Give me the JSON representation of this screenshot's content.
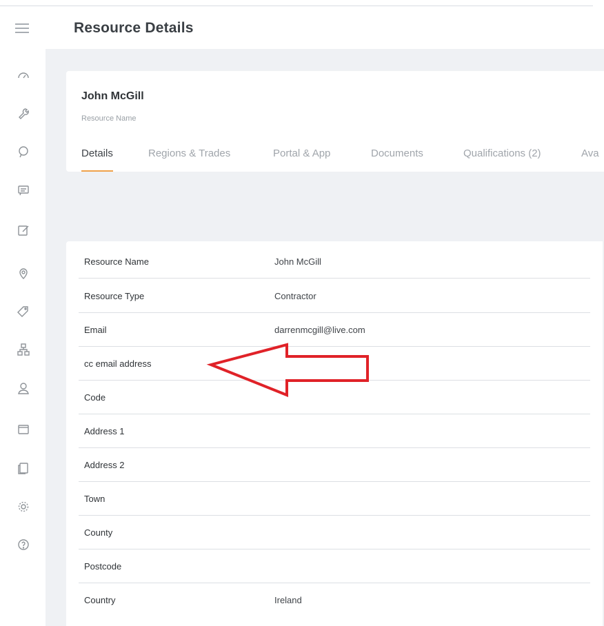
{
  "header": {
    "title": "Resource Details"
  },
  "sidebar": {
    "icons": [
      "dashboard-icon",
      "wrench-icon",
      "chat-icon",
      "message-icon",
      "edit-icon",
      "location-pin-icon",
      "tag-icon",
      "hierarchy-icon",
      "user-icon",
      "folder-icon",
      "documents-icon",
      "settings-icon",
      "help-icon"
    ]
  },
  "resource": {
    "name": "John McGill",
    "name_caption": "Resource Name"
  },
  "tabs": [
    {
      "label": "Details",
      "active": true
    },
    {
      "label": "Regions & Trades",
      "active": false
    },
    {
      "label": "Portal & App",
      "active": false
    },
    {
      "label": "Documents",
      "active": false
    },
    {
      "label": "Qualifications (2)",
      "active": false
    },
    {
      "label": "Ava",
      "active": false
    }
  ],
  "details": [
    {
      "label": "Resource Name",
      "value": "John McGill"
    },
    {
      "label": "Resource Type",
      "value": "Contractor"
    },
    {
      "label": "Email",
      "value": "darrenmcgill@live.com"
    },
    {
      "label": "cc email address",
      "value": ""
    },
    {
      "label": "Code",
      "value": ""
    },
    {
      "label": "Address 1",
      "value": ""
    },
    {
      "label": "Address 2",
      "value": ""
    },
    {
      "label": "Town",
      "value": ""
    },
    {
      "label": "County",
      "value": ""
    },
    {
      "label": "Postcode",
      "value": ""
    },
    {
      "label": "Country",
      "value": "Ireland"
    }
  ],
  "colors": {
    "accent": "#f0a24a",
    "annotation_arrow": "#e02228",
    "background": "#eff1f4"
  }
}
